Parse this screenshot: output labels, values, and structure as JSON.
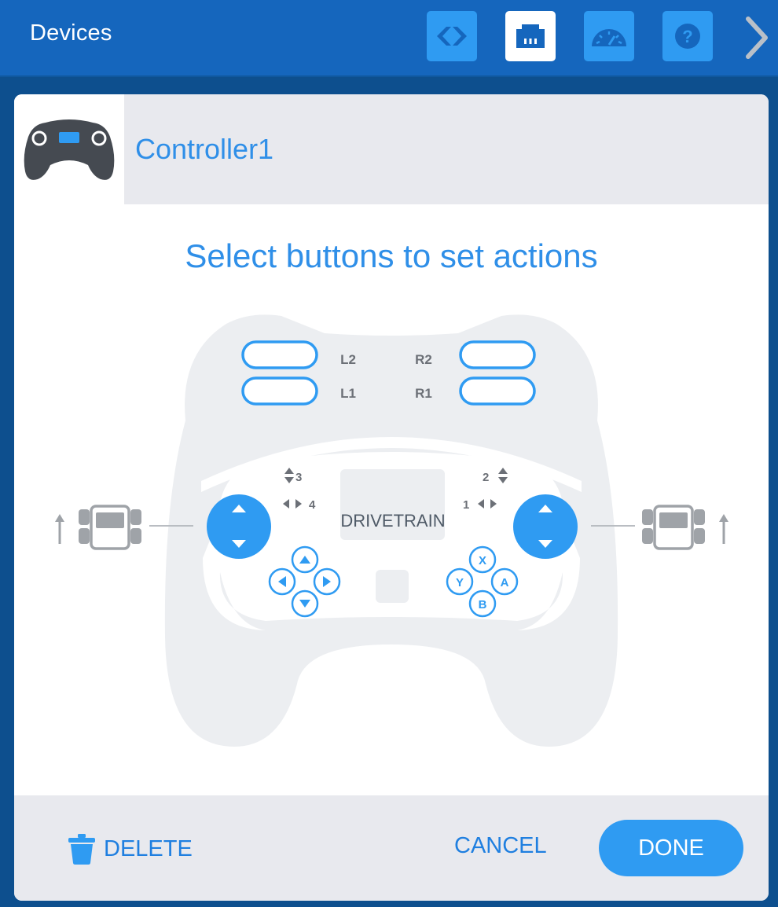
{
  "topbar": {
    "title": "Devices",
    "buttons": [
      {
        "icon": "code-icon",
        "active": false
      },
      {
        "icon": "ports-icon",
        "active": true
      },
      {
        "icon": "dashboard-gauge-icon",
        "active": false
      },
      {
        "icon": "help-icon",
        "active": false
      }
    ],
    "next_icon": "chevron-right-icon"
  },
  "device": {
    "name": "Controller1",
    "icon": "gamepad-icon"
  },
  "instruction": "Select buttons to set actions",
  "controller": {
    "bumpers": {
      "l2": "L2",
      "l1": "L1",
      "r2": "R2",
      "r1": "R1"
    },
    "axes": {
      "axis3": "3",
      "axis4": "4",
      "axis2": "2",
      "axis1": "1"
    },
    "screen_label": "DRIVETRAIN",
    "face_buttons": {
      "x": "X",
      "y": "Y",
      "a": "A",
      "b": "B"
    }
  },
  "footer": {
    "delete_label": "DELETE",
    "cancel_label": "CANCEL",
    "done_label": "DONE"
  },
  "colors": {
    "topbar": "#1566bd",
    "accent": "#2f9bf2",
    "accent_text": "#2f8fe8",
    "controller_body": "#eceef1",
    "drivetrain_icon": "#9fa3a8",
    "background": "#0d4f8e"
  }
}
